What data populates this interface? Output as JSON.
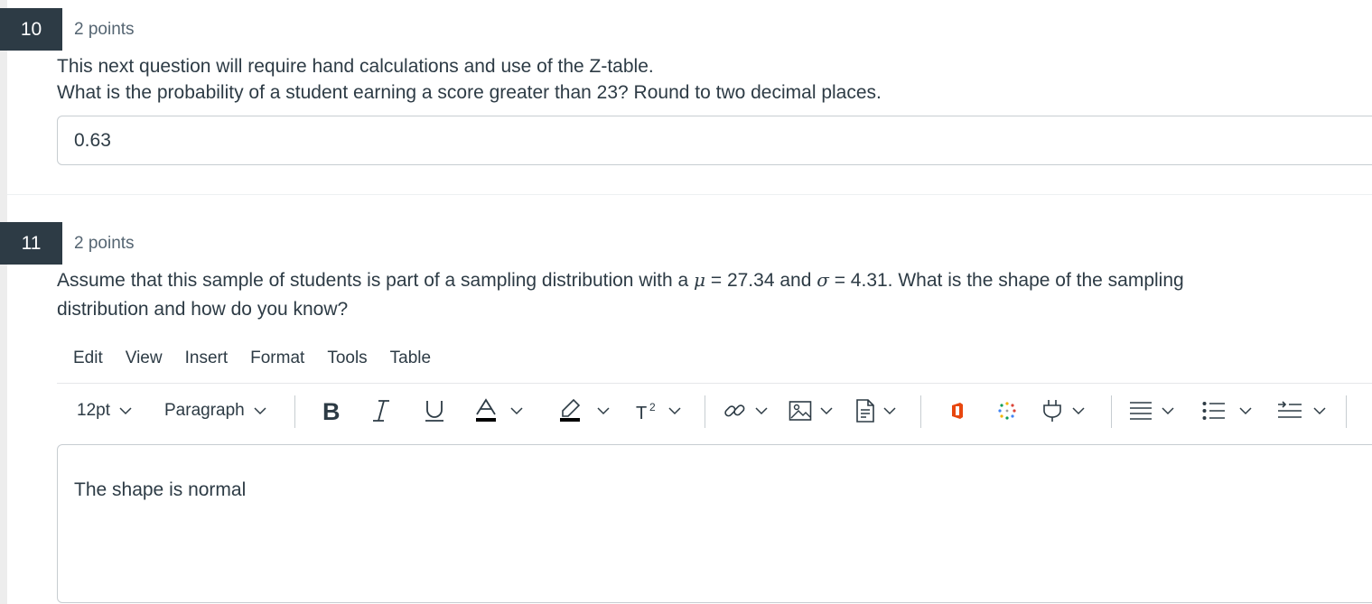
{
  "questions": [
    {
      "number": "10",
      "points": "2 points",
      "text_line1": "This next question will require hand calculations and use of the Z-table.",
      "text_line2": "What is the probability of a student earning a score greater than 23? Round to two decimal places.",
      "answer_value": "0.63"
    },
    {
      "number": "11",
      "points": "2 points",
      "text_before_mu": "Assume that this sample of students is part of a sampling distribution with a ",
      "mu_symbol": "μ",
      "text_mu_value": " = 27.34 and ",
      "sigma_symbol": "σ",
      "text_after_sigma": " = 4.31. What is the shape of the sampling",
      "text_line2": "distribution and how do you know?",
      "editor": {
        "menu": [
          "Edit",
          "View",
          "Insert",
          "Format",
          "Tools",
          "Table"
        ],
        "font_size": "12pt",
        "block_format": "Paragraph",
        "content": "The shape is normal"
      }
    }
  ],
  "toolbar_icons": [
    "chevron-down-icon",
    "bold-icon",
    "italic-icon",
    "underline-icon",
    "text-color-icon",
    "highlight-icon",
    "superscript-icon",
    "link-icon",
    "image-icon",
    "document-icon",
    "office-icon",
    "apps-icon",
    "plugin-icon",
    "align-icon",
    "bullet-list-icon",
    "indent-icon"
  ],
  "colors": {
    "text": "#2d3b45",
    "muted": "#556572",
    "badge_bg": "#2d3b45",
    "border": "#c7cdd1",
    "office_orange": "#e8470f"
  }
}
